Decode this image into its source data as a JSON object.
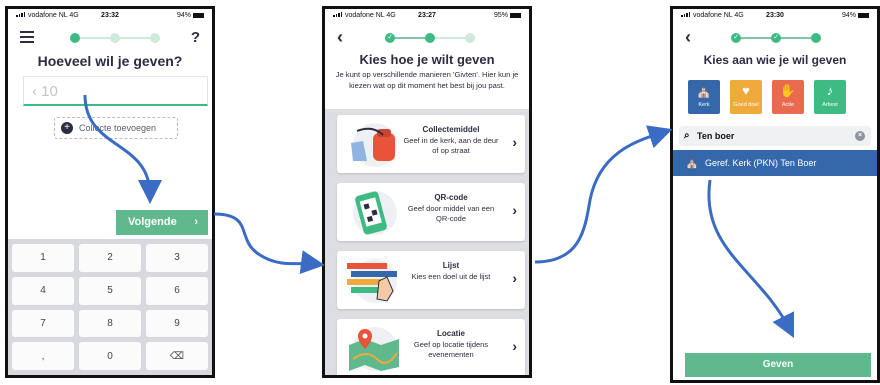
{
  "colors": {
    "green": "#3dbb82",
    "button_green": "#5fb98c",
    "blue": "#3468ab",
    "arrow": "#3a6cc4",
    "kerk": "#3468ab",
    "goed_doel": "#f0a93b",
    "actie": "#e96a4e",
    "artiest": "#3dbb82"
  },
  "screen1": {
    "status": {
      "carrier": "vodafone NL  4G",
      "time": "23:32",
      "battery": "94%"
    },
    "title": "Hoeveel wil je geven?",
    "amount_prefix": "‹",
    "amount_value": "10",
    "collecte_label": "Collecte toevoegen",
    "next_label": "Volgende",
    "keys": [
      "1",
      "2",
      "3",
      "4",
      "5",
      "6",
      "7",
      "8",
      "9",
      ",",
      "0",
      "⌫"
    ]
  },
  "screen2": {
    "status": {
      "carrier": "vodafone NL  4G",
      "time": "23:27",
      "battery": "95%"
    },
    "title": "Kies hoe je wilt geven",
    "intro": "Je kunt op verschillende manieren 'Givten'. Hier kun je kiezen wat op dit moment het best bij jou past.",
    "options": [
      {
        "title": "Collectemiddel",
        "desc": "Geef in de kerk, aan de deur of op straat",
        "icon": "collection-bag-icon"
      },
      {
        "title": "QR-code",
        "desc": "Geef door middel van een QR-code",
        "icon": "qr-phone-icon"
      },
      {
        "title": "Lijst",
        "desc": "Kies een doel uit de lijst",
        "icon": "list-icon"
      },
      {
        "title": "Locatie",
        "desc": "Geef op locatie tijdens evenementen",
        "icon": "map-pin-icon"
      }
    ]
  },
  "screen3": {
    "status": {
      "carrier": "vodafone NL  4G",
      "time": "23:30",
      "battery": "94%"
    },
    "title": "Kies aan wie je wil geven",
    "categories": [
      {
        "label": "Kerk",
        "icon": "church-icon"
      },
      {
        "label": "Goed doel",
        "icon": "heart-hand-icon"
      },
      {
        "label": "Actie",
        "icon": "hand-icon"
      },
      {
        "label": "Artiest",
        "icon": "guitar-icon"
      }
    ],
    "search_value": "Ten boer",
    "result": "Geref. Kerk (PKN) Ten Boer",
    "give_label": "Geven"
  }
}
